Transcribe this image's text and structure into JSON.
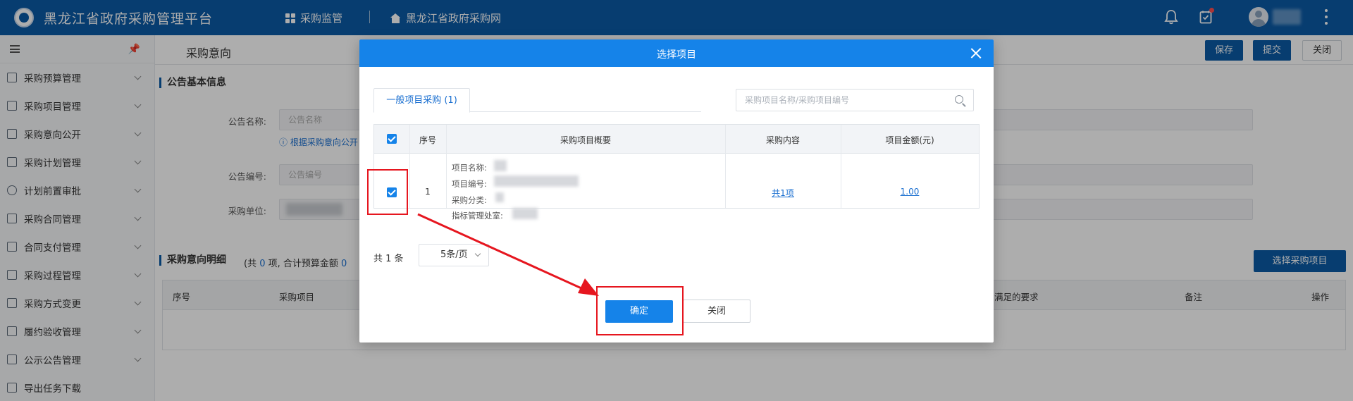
{
  "topbar": {
    "title": "黑龙江省政府采购管理平台",
    "nav": [
      "采购监管",
      "黑龙江省政府采购网"
    ]
  },
  "sidebar": {
    "items": [
      "采购预算管理",
      "采购项目管理",
      "采购意向公开",
      "采购计划管理",
      "计划前置审批",
      "采购合同管理",
      "合同支付管理",
      "采购过程管理",
      "采购方式变更",
      "履约验收管理",
      "公示公告管理",
      "导出任务下载"
    ]
  },
  "main": {
    "page_title": "采购意向",
    "buttons": {
      "save": "保存",
      "submit": "提交",
      "close": "关闭"
    },
    "section_basic": "公告基本信息",
    "form": {
      "name_label": "公告名称:",
      "name_placeholder": "公告名称",
      "hint": "ⓘ 根据采购意向公开",
      "code_label": "公告编号:",
      "code_placeholder": "公告编号",
      "unit_label": "采购单位:"
    },
    "section_detail": "采购意向明细",
    "detail_summary": {
      "prefix": "(共 ",
      "count": "0",
      "middle": " 项,  合计预算金额 ",
      "amount": "0"
    },
    "select_button": "选择采购项目",
    "detail_columns": [
      "序号",
      "采购项目",
      "满足的要求",
      "备注",
      "操作"
    ]
  },
  "modal": {
    "title": "选择项目",
    "tab": "一般项目采购 (1)",
    "search_placeholder": "采购项目名称/采购项目编号",
    "columns": [
      "序号",
      "采购项目概要",
      "采购内容",
      "项目金额(元)"
    ],
    "rows": [
      {
        "index": "1",
        "summary_labels": [
          "项目名称:",
          "项目编号:",
          "采购分类:",
          "指标管理处室:"
        ],
        "content": "共1项",
        "amount": "1.00"
      }
    ],
    "total": "共 1 条",
    "page_size": "5条/页",
    "ok": "确定",
    "cancel": "关闭"
  },
  "colors": {
    "topbar": "#0b5aa6",
    "modal_header": "#1583e9",
    "annotation": "#e6161f"
  }
}
